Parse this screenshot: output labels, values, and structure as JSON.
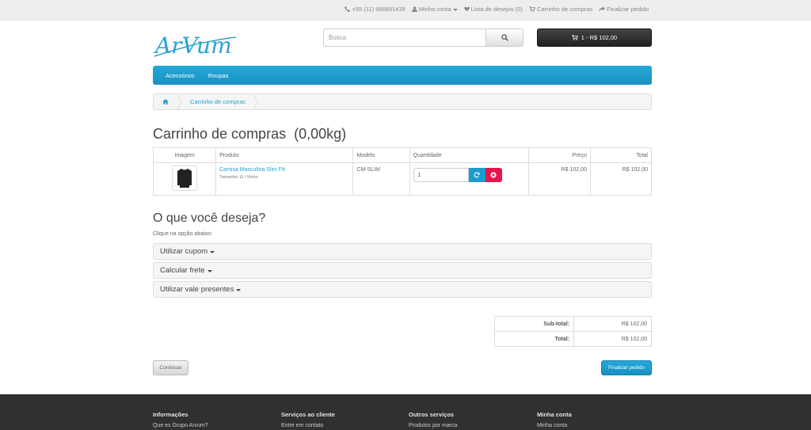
{
  "topbar": {
    "phone": "+55 (11) 986891439",
    "account": "Minha conta",
    "wishlist": "Lista de desejos (0)",
    "cart": "Carrinho de compras",
    "checkout": "Finalizar pedido"
  },
  "header": {
    "logo_text": "ArVum",
    "search_placeholder": "Busca",
    "cart_summary": "1 - R$ 102,00"
  },
  "menu": [
    "Acessórios",
    "Roupas"
  ],
  "breadcrumb": {
    "current": "Carrinho de compras"
  },
  "page": {
    "title": "Carrinho de compras  (0,00kg)"
  },
  "cart_table": {
    "headers": [
      "Imagem",
      "Produto",
      "Modelo",
      "Quantidade",
      "Preço",
      "Total"
    ],
    "rows": [
      {
        "product": "Camisa Masculina Slim Fit",
        "option": "Tamanho: G / Vinho",
        "model": "CM-SLIM",
        "quantity": "1",
        "price": "R$ 102,00",
        "total": "R$ 102,00"
      }
    ]
  },
  "wish": {
    "title": "O que você deseja?",
    "subtitle": "Clique na opção abaixo:",
    "panels": [
      "Utilizar cupom",
      "Calcular frete",
      "Utilizar vale presentes"
    ]
  },
  "totals": [
    {
      "label": "Sub-total:",
      "value": "R$ 102,00"
    },
    {
      "label": "Total:",
      "value": "R$ 102,00"
    }
  ],
  "buttons": {
    "continue": "Continuar",
    "checkout": "Finalizar pedido"
  },
  "footer": [
    {
      "heading": "Informações",
      "link": "Que es Grupo Arvum?"
    },
    {
      "heading": "Serviços ao cliente",
      "link": "Entre em contato"
    },
    {
      "heading": "Outros serviços",
      "link": "Produtos por marca"
    },
    {
      "heading": "Minha conta",
      "link": "Minha conta"
    }
  ],
  "colors": {
    "accent": "#23a9d8",
    "remove": "#e4174c",
    "dark": "#303030"
  }
}
